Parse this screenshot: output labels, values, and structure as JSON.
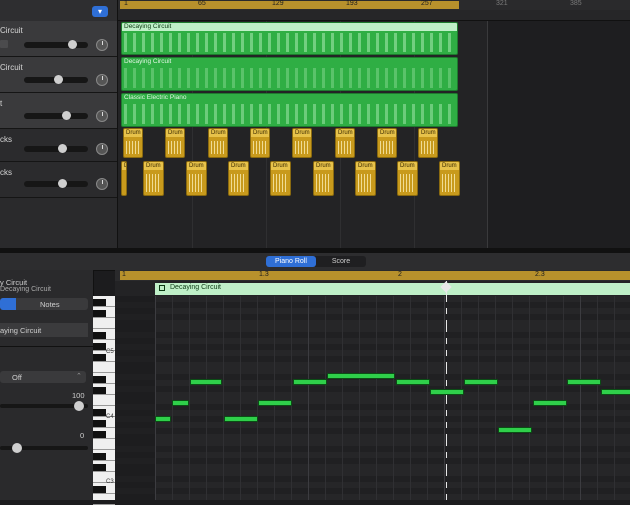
{
  "colors": {
    "accent": "#2f6fd6",
    "midi_region": "#2fae44",
    "audio_region": "#c89a1c",
    "cycle": "#b8912c",
    "note": "#2fcf4a"
  },
  "toolbar": {
    "add_track_icon": "chevron-down-icon"
  },
  "ruler": {
    "marks": [
      "1",
      "65",
      "129",
      "193",
      "257",
      "321",
      "385"
    ]
  },
  "tracks": [
    {
      "name": "Circuit"
    },
    {
      "name": "Circuit"
    },
    {
      "name": "t"
    },
    {
      "name": "cks"
    },
    {
      "name": "cks"
    }
  ],
  "regions": {
    "track1": "Decaying Circuit",
    "track2": "Decaying Circuit",
    "track3": "Classic Electric Piano",
    "drum_label": "Drum"
  },
  "editor": {
    "tabs": [
      "Piano Roll",
      "Score"
    ],
    "selected_tab": "Piano Roll"
  },
  "inspector": {
    "title": "y Circuit",
    "subtitle": "Decaying Circuit",
    "seg_tab_2": "Notes",
    "region_name": "aying Circuit",
    "quantize_value": "Off",
    "quantize_stepper": "⌃",
    "strength_value": "100",
    "swing_value": "0",
    "octave_labels": [
      "C5",
      "C4",
      "C3"
    ]
  },
  "roll": {
    "ruler_marks": [
      "1",
      "1.3",
      "2",
      "2.3"
    ],
    "region_name": "Decaying Circuit"
  }
}
